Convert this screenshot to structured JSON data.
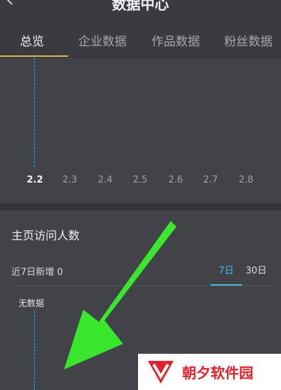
{
  "header": {
    "title": "数据中心"
  },
  "tabs": [
    {
      "label": "总览",
      "active": true
    },
    {
      "label": "企业数据",
      "active": false
    },
    {
      "label": "作品数据",
      "active": false
    },
    {
      "label": "粉丝数据",
      "active": false
    }
  ],
  "top_chart": {
    "x_labels": [
      "2.2",
      "2.3",
      "2.4",
      "2.5",
      "2.6",
      "2.7",
      "2.8"
    ],
    "selected_index": 0
  },
  "visitors": {
    "title": "主页访问人数",
    "new_label": "近7日新增 0",
    "ranges": [
      "7日",
      "30日"
    ],
    "selected_range": "7日",
    "empty_text": "无数据"
  },
  "colors": {
    "accent_tab": "#d8b44a",
    "accent_range": "#4cb2e0",
    "annotation_arrow": "#39e82c",
    "watermark_red": "#e2212d"
  },
  "watermark": {
    "text": "朝夕软件园"
  }
}
